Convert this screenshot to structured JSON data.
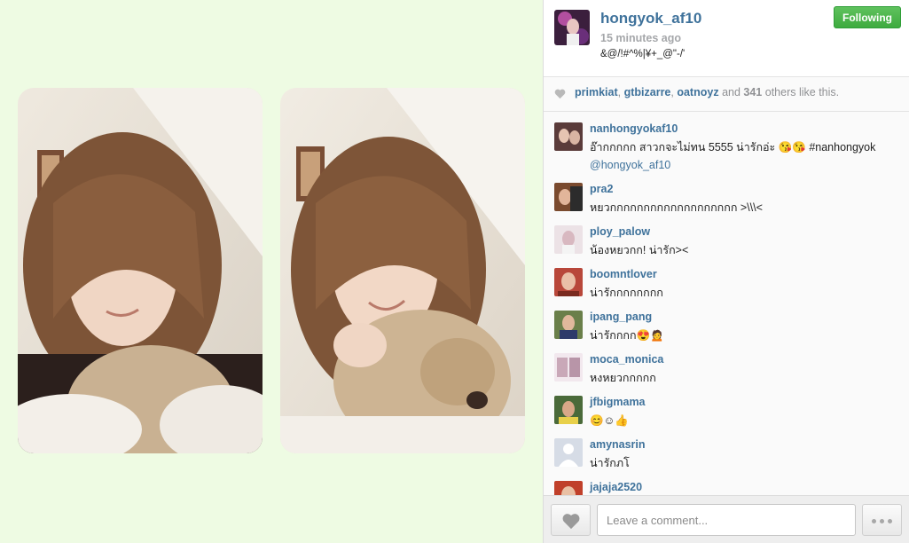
{
  "post": {
    "username": "hongyok_af10",
    "time": "15 minutes ago",
    "caption": "&@/!#^%|¥+_@\"-/'",
    "follow_label": "Following"
  },
  "likes": {
    "user1": "primkiat",
    "user2": "gtbizarre",
    "user3": "oatnoyz",
    "and_word": "and",
    "count": "341",
    "suffix": "others like this."
  },
  "comments": [
    {
      "user": "nanhongyokaf10",
      "text": "อ๊ากกกกก สาวกจะไม่ทน 5555 น่ารักอ่ะ 😘😘 #nanhongyok",
      "mention": "@hongyok_af10",
      "avatar_color": "#5a3b3a"
    },
    {
      "user": "pra2",
      "text": "หยวกกกกกกกกกกกกกกกกกกก >\\\\\\<",
      "avatar_color": "#7a4a2e"
    },
    {
      "user": "ploy_palow",
      "text": "น้องหยวกก! น่ารัก><",
      "avatar_color": "#d8b8c0"
    },
    {
      "user": "boomntlover",
      "text": "น่ารักกกกกกกก",
      "avatar_color": "#b8473a"
    },
    {
      "user": "ipang_pang",
      "text": "น่ารักกกก😍🙍",
      "avatar_color": "#6a7f4a"
    },
    {
      "user": "moca_monica",
      "text": "หงหยวกกกกก",
      "avatar_color": "#c9a8b8"
    },
    {
      "user": "jfbigmama",
      "text": "😊☺👍",
      "avatar_color": "#4a6a3a"
    },
    {
      "user": "amynasrin",
      "text": "น่ารักภโ",
      "avatar_color": "#d6dce6"
    },
    {
      "user": "jajaja2520",
      "text": "",
      "avatar_color": "#c0402a"
    }
  ],
  "footer": {
    "comment_placeholder": "Leave a comment..."
  },
  "colors": {
    "link": "#3f729b",
    "follow_green": "#3eab3f",
    "photo_background": "#eefbe3"
  },
  "icons": {
    "likes": "heart-icon",
    "like_button": "heart-icon",
    "more": "ellipsis-icon"
  }
}
